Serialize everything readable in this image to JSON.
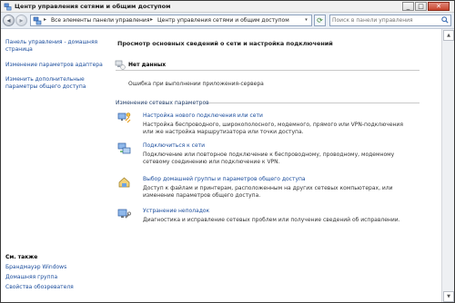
{
  "window": {
    "title": "Центр управления сетями и общим доступом",
    "close": "✕",
    "min": "_",
    "max": "□"
  },
  "address": {
    "seg1": "Все элементы панели управления",
    "sep": "▸",
    "seg2": "Центр управления сетями и общим доступом",
    "caret": "▸",
    "dropdown": "▾"
  },
  "search": {
    "placeholder": "Поиск в панели управления"
  },
  "sidebar": {
    "links": [
      "Панель управления - домашняя страница",
      "Изменение параметров адаптера",
      "Изменить дополнительные параметры общего доступа"
    ],
    "see_also": "См. также",
    "see_also_links": [
      "Брандмауэр Windows",
      "Домашняя группа",
      "Свойства обозревателя"
    ]
  },
  "main": {
    "heading": "Просмотр основных сведений о сети и настройка подключений",
    "no_data": "Нет данных",
    "error": "Ошибка при выполнении приложения-сервера",
    "section": "Изменение сетевых параметров",
    "tasks": [
      {
        "link": "Настройка нового подключения или сети",
        "desc": "Настройка беспроводного, широкополосного, модемного, прямого или VPN-подключения или же настройка маршрутизатора или точки доступа."
      },
      {
        "link": "Подключиться к сети",
        "desc": "Подключение или повторное подключение к беспроводному, проводному, модемному сетевому соединению или подключение к VPN."
      },
      {
        "link": "Выбор домашней группы и параметров общего доступа",
        "desc": "Доступ к файлам и принтерам, расположенным на других сетевых компьютерах, или изменение параметров общего доступа."
      },
      {
        "link": "Устранение неполадок",
        "desc": "Диагностика и исправление сетевых проблем или получение сведений об исправлении."
      }
    ]
  },
  "icons": {
    "window": "network-icon",
    "address": "network-icon",
    "refresh": "refresh-icon",
    "search": "search-icon",
    "no_data": "network-icon",
    "tasks": [
      "new-connection-icon",
      "connect-network-icon",
      "homegroup-icon",
      "troubleshoot-icon"
    ]
  },
  "colors": {
    "link": "#1a4c9c",
    "section": "#1e3a66",
    "titlebar": "#f0f0f0",
    "addressbar": "#e9eef5"
  }
}
